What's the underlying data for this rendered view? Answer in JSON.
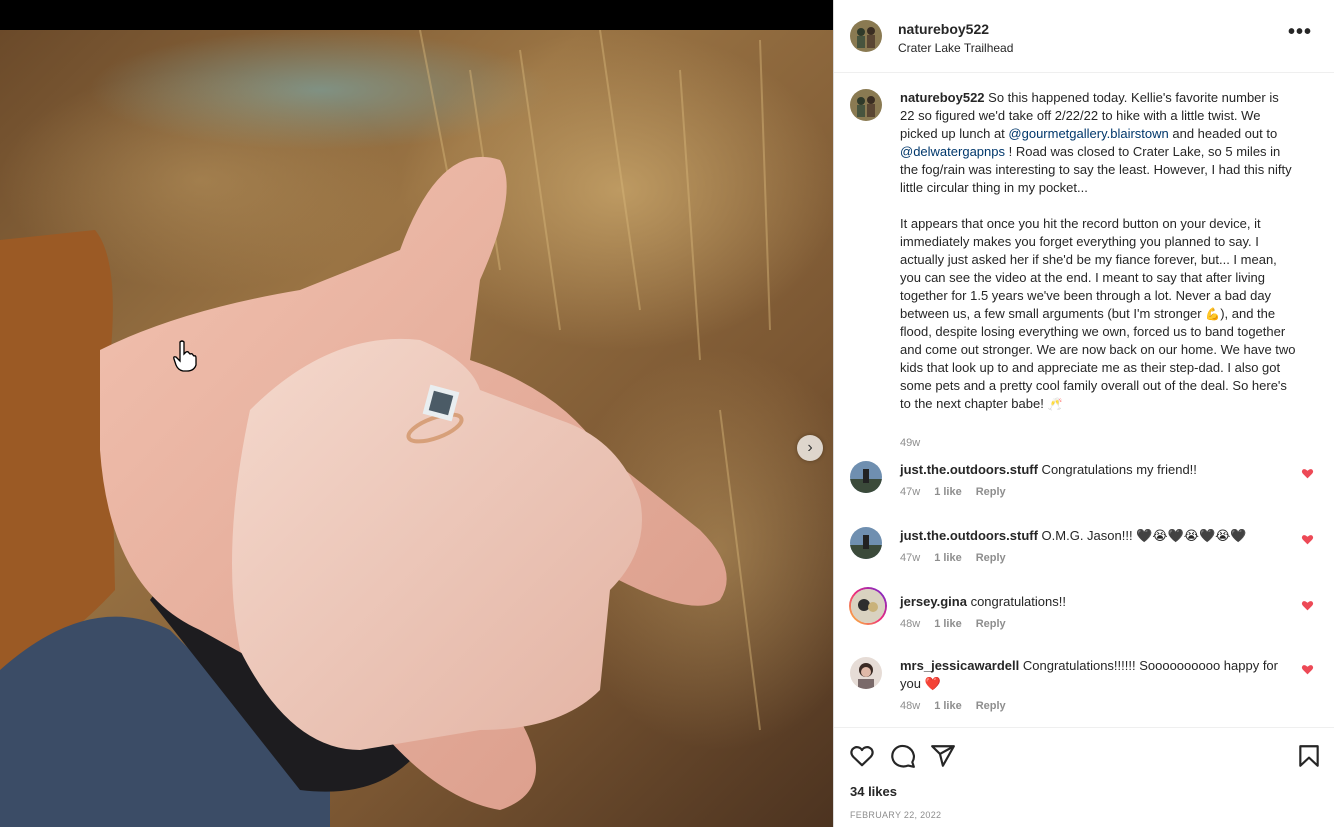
{
  "post": {
    "username": "natureboy522",
    "location": "Crater Lake Trailhead",
    "more_label": "•••",
    "caption_user": "natureboy522",
    "caption_p1_a": " So this happened today. Kellie's favorite number is 22 so figured we'd take off 2/22/22 to hike with a little twist. We picked up lunch at ",
    "caption_mention1": "@gourmetgallery.blairstown",
    "caption_p1_b": " and headed out to ",
    "caption_mention2": "@delwatergapnps",
    "caption_p1_c": " ! Road was closed to Crater Lake, so 5 miles in the fog/rain was interesting to say the least. However, I had this nifty little circular thing in my pocket...",
    "caption_p2_a": "It appears that once you hit the record button on your device, it immediately makes you forget everything you planned to say. I actually just asked her if she'd be my fiance forever, but... I mean, you can see the video at the end. I meant to say that after living together for 1.5 years we've been through a lot. Never a bad day between us, a few small arguments (but I'm stronger ",
    "caption_emoji1": "💪",
    "caption_p2_b": "), and the flood, despite losing everything we own, forced us to band together and come out stronger. We are now back on our home. We have two kids that look up to and appreciate me as their step-dad. I also got some pets and a pretty cool family overall out of the deal. So here's to the next chapter babe! ",
    "caption_emoji2": "🥂",
    "caption_time": "49w",
    "likes": "34 likes",
    "date": "FEBRUARY 22, 2022",
    "next_arrow": "›"
  },
  "comments": [
    {
      "user": "just.the.outdoors.stuff",
      "text": " Congratulations my friend!!",
      "time": "47w",
      "likes": "1 like",
      "reply": "Reply"
    },
    {
      "user": "just.the.outdoors.stuff",
      "text": " O.M.G. Jason!!! 🖤😭🖤😭🖤😭🖤",
      "time": "47w",
      "likes": "1 like",
      "reply": "Reply"
    },
    {
      "user": "jersey.gina",
      "text": " congratulations!!",
      "time": "48w",
      "likes": "1 like",
      "reply": "Reply"
    },
    {
      "user": "mrs_jessicawardell",
      "text": " Congratulations!!!!!! Soooooooooo happy for you ❤️",
      "time": "48w",
      "likes": "1 like",
      "reply": "Reply"
    }
  ],
  "colors": {
    "heart_red": "#ed4956",
    "mention_blue": "#00376b",
    "muted": "#8e8e8e"
  },
  "icons": [
    "heart-icon",
    "comment-icon",
    "share-icon",
    "bookmark-icon",
    "more-icon",
    "chevron-right-icon",
    "hand-cursor-icon"
  ]
}
